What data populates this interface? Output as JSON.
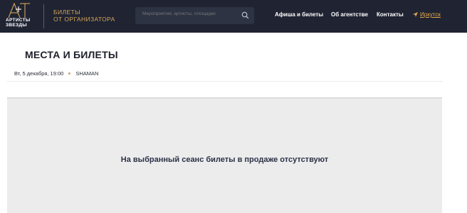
{
  "header": {
    "logo_text": [
      "АРТИСТЫ",
      "ЗВЕЗДЫ"
    ],
    "tagline": [
      "БИЛЕТЫ",
      "ОТ ОРГАНИЗАТОРА"
    ],
    "search_placeholder": "Мероприятия, артисты, площадки",
    "nav": {
      "afisha": "Афиша и билеты",
      "about": "Об агентстве",
      "contacts": "Контакты",
      "city": "Иркутск"
    },
    "colors": {
      "background": "#1f2332",
      "accent": "#d4a45a"
    }
  },
  "main": {
    "title": "МЕСТА И БИЛЕТЫ",
    "event_date": "Вт, 5 декабря, 19:00",
    "event_artist": "SHAMAN",
    "message": "На выбранный сеанс билеты в продаже отсутствуют"
  }
}
